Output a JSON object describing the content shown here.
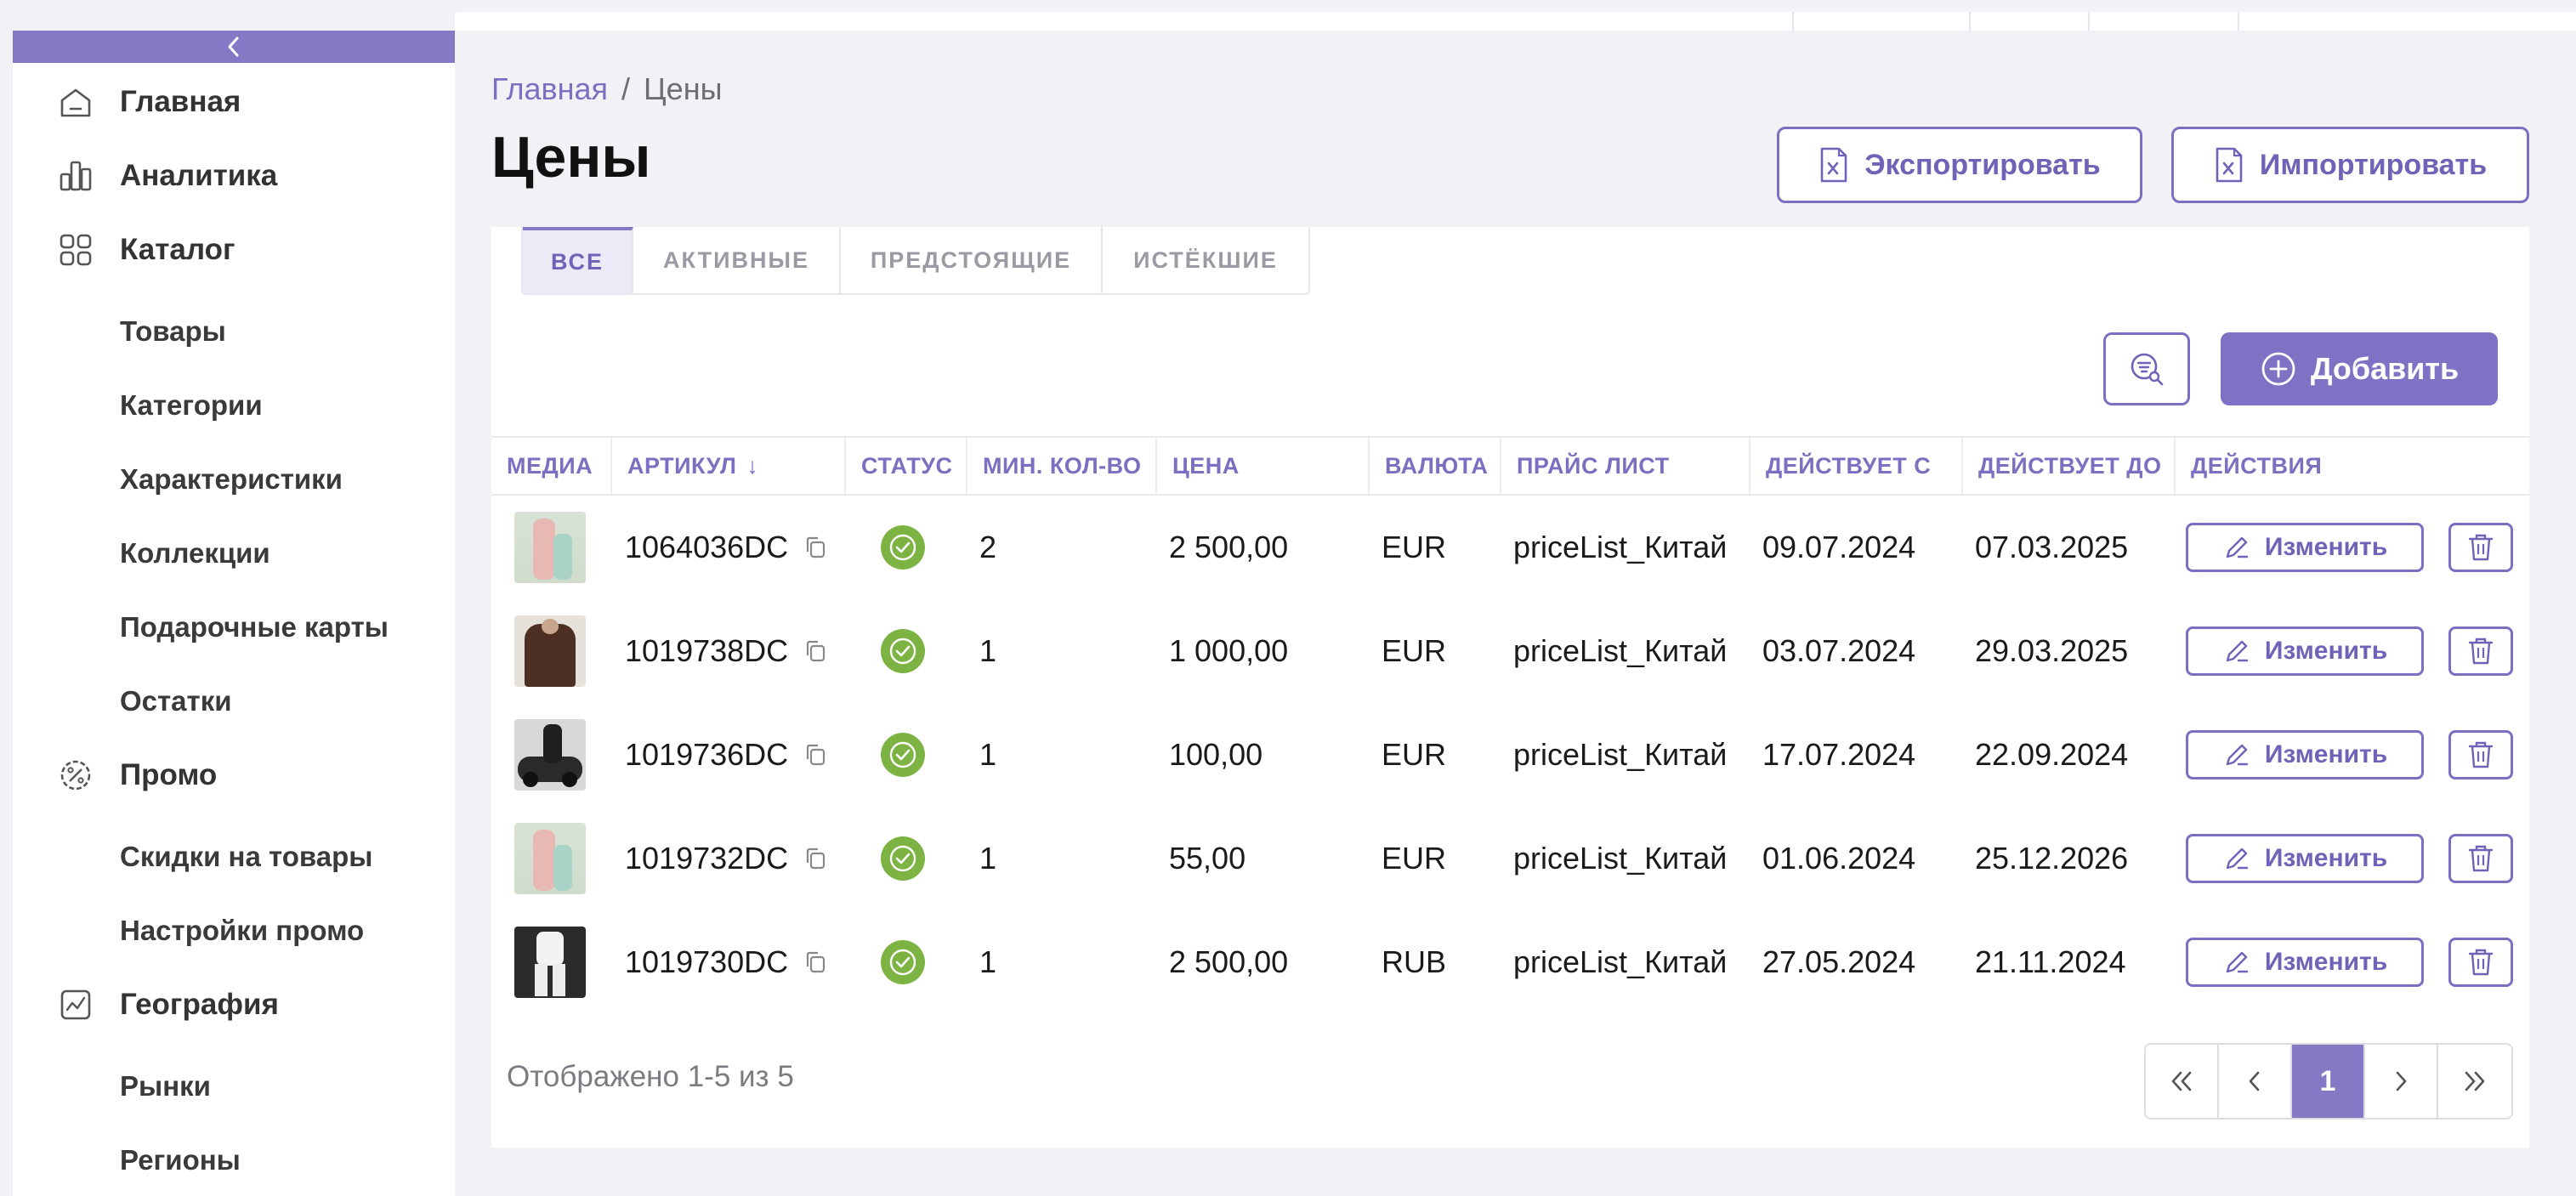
{
  "sidebar": {
    "collapse_icon": "chevron-left-icon",
    "items": [
      {
        "label": "Главная",
        "icon": "home-icon"
      },
      {
        "label": "Аналитика",
        "icon": "bar-chart-icon"
      },
      {
        "label": "Каталог",
        "icon": "grid-icon"
      },
      {
        "label": "Товары"
      },
      {
        "label": "Категории"
      },
      {
        "label": "Характеристики"
      },
      {
        "label": "Коллекции"
      },
      {
        "label": "Подарочные карты"
      },
      {
        "label": "Остатки"
      },
      {
        "label": "Промо",
        "icon": "percent-gear-icon"
      },
      {
        "label": "Скидки на товары"
      },
      {
        "label": "Настройки промо"
      },
      {
        "label": "География",
        "icon": "map-chart-icon"
      },
      {
        "label": "Рынки"
      },
      {
        "label": "Регионы"
      }
    ]
  },
  "breadcrumb": {
    "home": "Главная",
    "separator": "/",
    "current": "Цены"
  },
  "page_title": "Цены",
  "header_actions": {
    "export_label": "Экспортировать",
    "import_label": "Импортировать"
  },
  "tabs": [
    "ВСЕ",
    "АКТИВНЫЕ",
    "ПРЕДСТОЯЩИЕ",
    "ИСТЁКШИЕ"
  ],
  "active_tab": "ВСЕ",
  "toolbar": {
    "add_label": "Добавить"
  },
  "table": {
    "columns": [
      "МЕДИА",
      "АРТИКУЛ",
      "СТАТУС",
      "МИН. КОЛ-ВО",
      "ЦЕНА",
      "ВАЛЮТА",
      "ПРАЙС ЛИСТ",
      "ДЕЙСТВУЕТ С",
      "ДЕЙСТВУЕТ ДО",
      "ДЕЙСТВИЯ"
    ],
    "sort_indicator": "↓",
    "edit_label": "Изменить",
    "rows": [
      {
        "sku": "1064036DC",
        "min_qty": "2",
        "price": "2 500,00",
        "currency": "EUR",
        "price_list": "priceList_Китай",
        "from": "09.07.2024",
        "to": "07.03.2025",
        "status": "active"
      },
      {
        "sku": "1019738DC",
        "min_qty": "1",
        "price": "1 000,00",
        "currency": "EUR",
        "price_list": "priceList_Китай",
        "from": "03.07.2024",
        "to": "29.03.2025",
        "status": "active"
      },
      {
        "sku": "1019736DC",
        "min_qty": "1",
        "price": "100,00",
        "currency": "EUR",
        "price_list": "priceList_Китай",
        "from": "17.07.2024",
        "to": "22.09.2024",
        "status": "active"
      },
      {
        "sku": "1019732DC",
        "min_qty": "1",
        "price": "55,00",
        "currency": "EUR",
        "price_list": "priceList_Китай",
        "from": "01.06.2024",
        "to": "25.12.2026",
        "status": "active"
      },
      {
        "sku": "1019730DC",
        "min_qty": "1",
        "price": "2 500,00",
        "currency": "RUB",
        "price_list": "priceList_Китай",
        "from": "27.05.2024",
        "to": "21.11.2024",
        "status": "active"
      }
    ]
  },
  "footer": {
    "summary": "Отображено 1-5 из 5"
  },
  "pagination": {
    "current_page": "1"
  },
  "colors": {
    "accent": "#7f72c4",
    "status_ok": "#7cb342",
    "background": "#f2f2f6"
  }
}
